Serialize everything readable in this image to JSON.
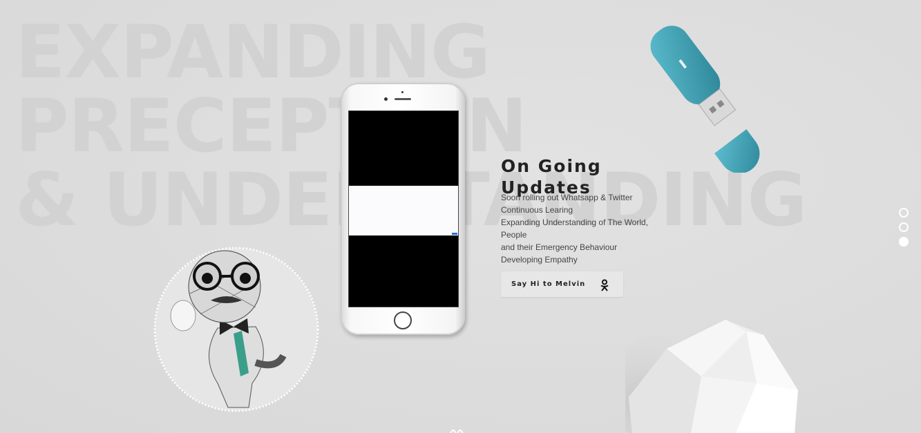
{
  "background_text": {
    "line1": "EXPANDING",
    "line2": "PRECEPTION",
    "line3": "& UNDERSTANDING"
  },
  "section": {
    "title": "On Going Updates",
    "updates": [
      "Soon rolling out Whatsapp & Twitter",
      "Continuous Learing",
      "Expanding Understanding of The World, People",
      "and their Emergency Behaviour",
      "Developing Empathy"
    ],
    "cta_label": "Say Hi to Melvin",
    "cta_icon": "odnoklassniki-icon"
  },
  "pager": {
    "total": 3,
    "active_index": 2
  },
  "colors": {
    "background": "#dcdcdc",
    "usb_teal": "#3a9fb2",
    "title": "#222222"
  }
}
